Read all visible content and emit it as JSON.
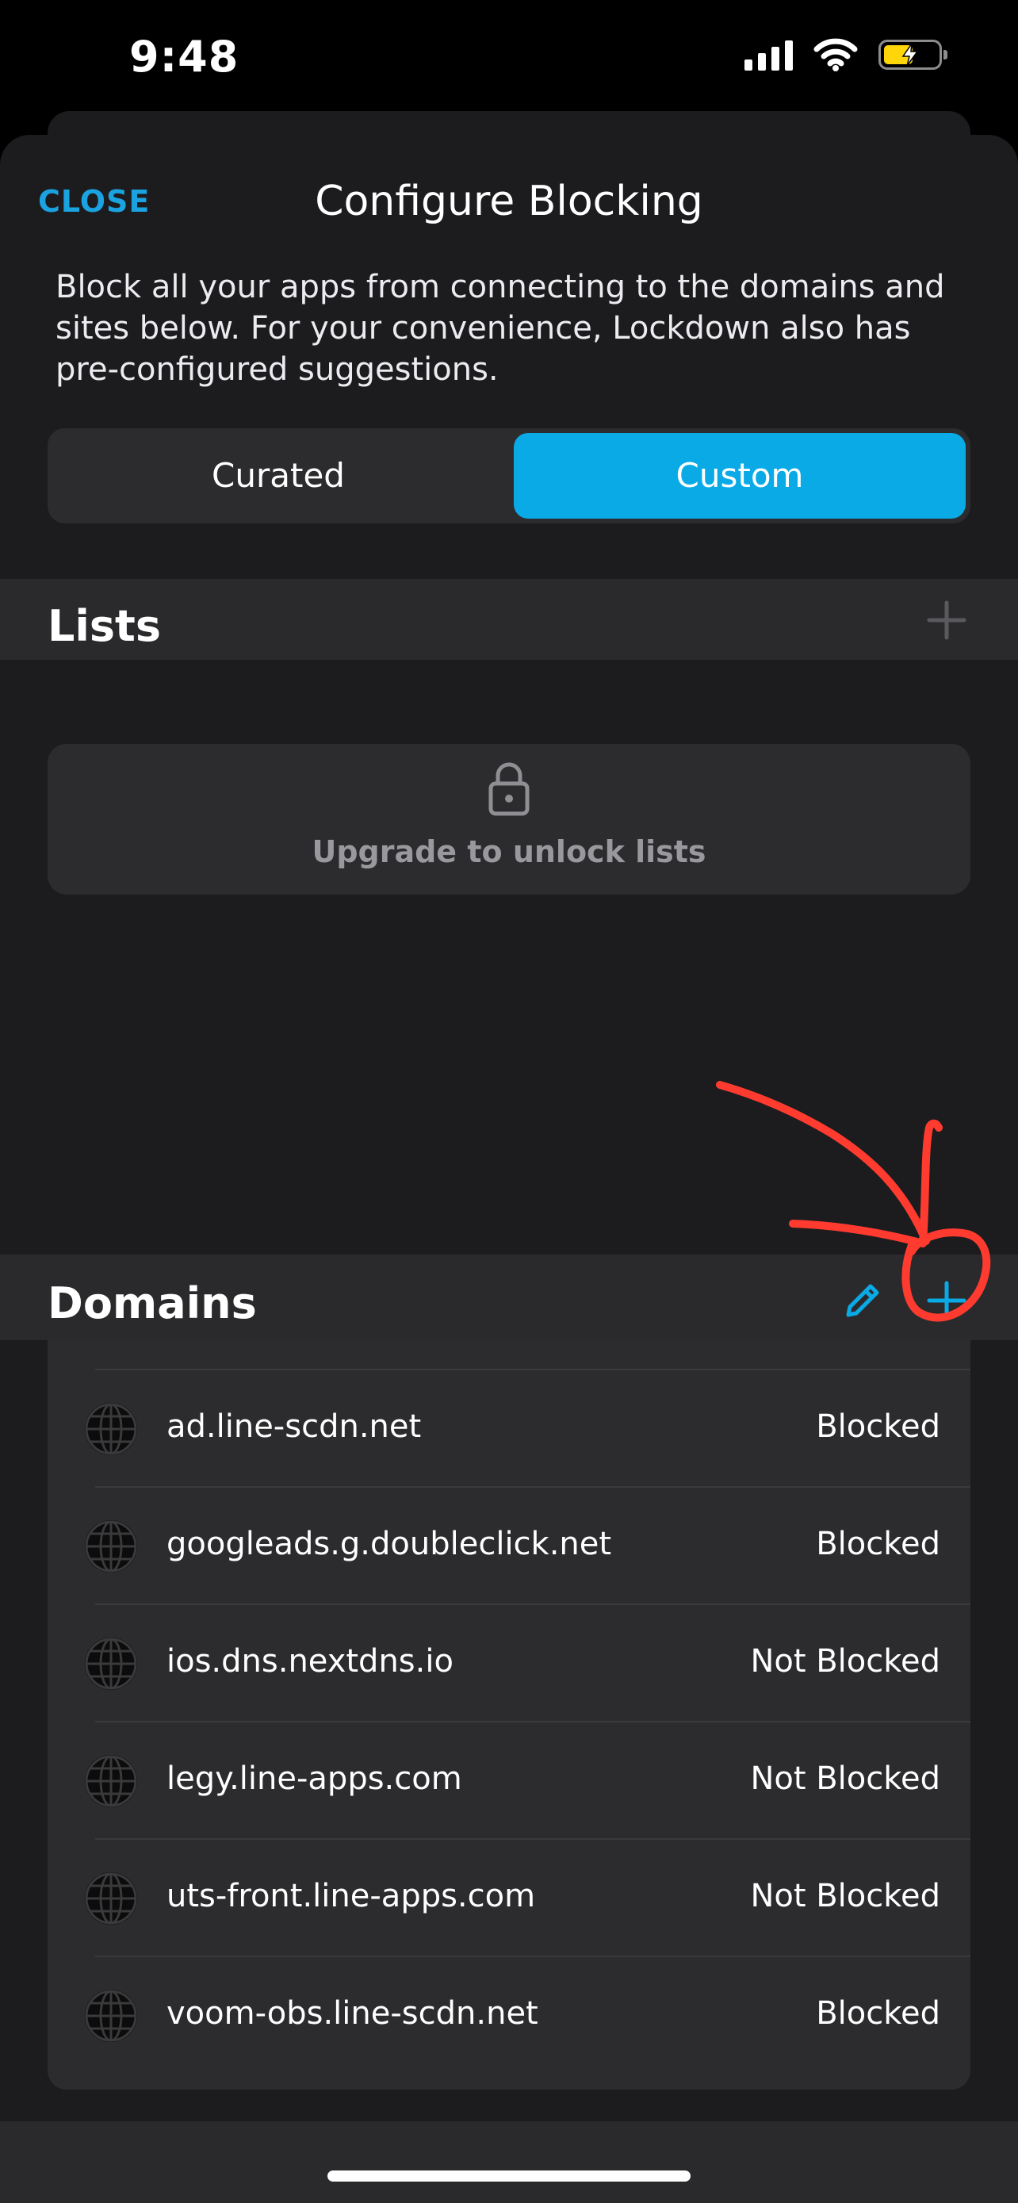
{
  "status_bar": {
    "time": "9:48"
  },
  "header": {
    "close_label": "CLOSE",
    "title": "Configure Blocking"
  },
  "description": "Block all your apps from connecting to the domains and sites below. For your convenience, Lockdown also has pre-configured suggestions.",
  "segmented_control": {
    "options": [
      "Curated",
      "Custom"
    ],
    "selected": "Custom"
  },
  "lists_section": {
    "title": "Lists",
    "upgrade_text": "Upgrade to unlock lists"
  },
  "domains_section": {
    "title": "Domains",
    "items": [
      {
        "domain": "ad.line-scdn.net",
        "status": "Blocked"
      },
      {
        "domain": "googleads.g.doubleclick.net",
        "status": "Blocked"
      },
      {
        "domain": "ios.dns.nextdns.io",
        "status": "Not Blocked"
      },
      {
        "domain": "legy.line-apps.com",
        "status": "Not Blocked"
      },
      {
        "domain": "uts-front.line-apps.com",
        "status": "Not Blocked"
      },
      {
        "domain": "voom-obs.line-scdn.net",
        "status": "Blocked"
      }
    ]
  },
  "colors": {
    "accent": "#0aaae6",
    "annotation": "#ff3b30",
    "battery": "#ffd60a"
  }
}
